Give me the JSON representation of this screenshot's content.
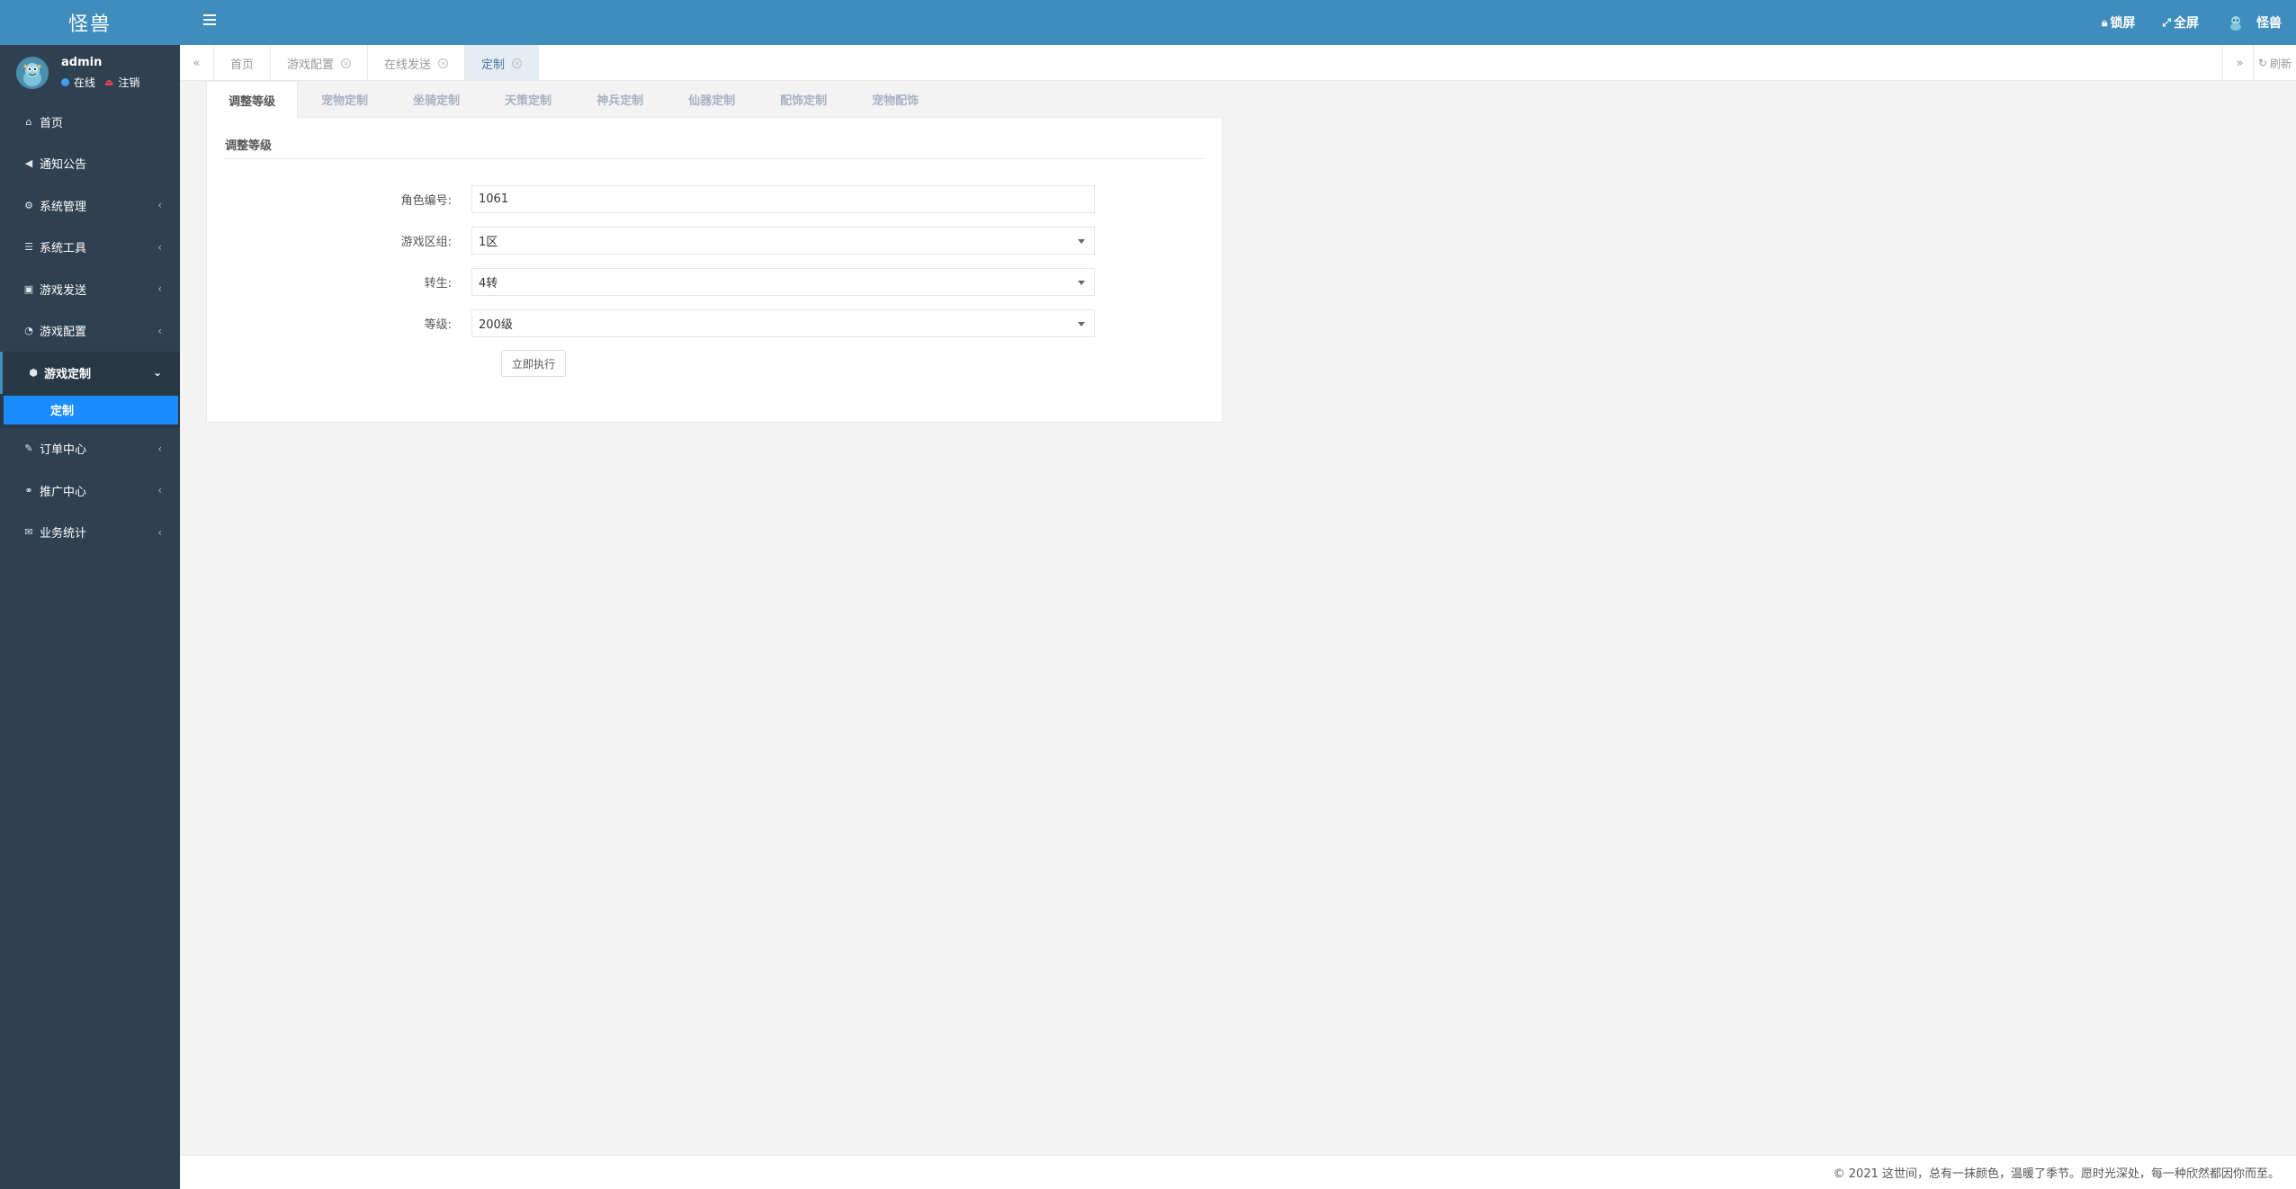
{
  "brand": {
    "title": "怪兽"
  },
  "user": {
    "name": "admin",
    "status": "在线",
    "logout": "注销"
  },
  "sidebar": {
    "items": [
      {
        "label": "首页",
        "icon": "home-icon",
        "glyph": "⌂",
        "has_arrow": false
      },
      {
        "label": "通知公告",
        "icon": "bullhorn-icon",
        "glyph": "📢",
        "has_arrow": false
      },
      {
        "label": "系统管理",
        "icon": "gear-icon",
        "glyph": "⚙",
        "has_arrow": true
      },
      {
        "label": "系统工具",
        "icon": "bars-icon",
        "glyph": "☰",
        "has_arrow": true
      },
      {
        "label": "游戏发送",
        "icon": "gift-icon",
        "glyph": "🎁",
        "has_arrow": true
      },
      {
        "label": "游戏配置",
        "icon": "dashboard-icon",
        "glyph": "◔",
        "has_arrow": true
      }
    ],
    "active_group": {
      "label": "游戏定制",
      "icon": "cube-icon",
      "glyph": "⬡",
      "sub_item": "定制"
    },
    "items_after": [
      {
        "label": "订单中心",
        "icon": "brush-icon",
        "glyph": "✎",
        "has_arrow": true
      },
      {
        "label": "推广中心",
        "icon": "handshake-icon",
        "glyph": "🤝",
        "has_arrow": true
      },
      {
        "label": "业务统计",
        "icon": "envelope-icon",
        "glyph": "✉",
        "has_arrow": true
      }
    ]
  },
  "header": {
    "lock": "锁屏",
    "fullscreen": "全屏",
    "username": "怪兽"
  },
  "page_tabs": [
    {
      "label": "首页",
      "closable": false,
      "active": false
    },
    {
      "label": "游戏配置",
      "closable": true,
      "active": false
    },
    {
      "label": "在线发送",
      "closable": true,
      "active": false
    },
    {
      "label": "定制",
      "closable": true,
      "active": true
    }
  ],
  "refresh": "刷新",
  "content_tabs": [
    "调整等级",
    "宠物定制",
    "坐骑定制",
    "天策定制",
    "神兵定制",
    "仙器定制",
    "配饰定制",
    "宠物配饰"
  ],
  "panel": {
    "title": "调整等级",
    "fields": {
      "role_id": {
        "label": "角色编号:",
        "value": "1061"
      },
      "zone": {
        "label": "游戏区组:",
        "value": "1区"
      },
      "rebirth": {
        "label": "转生:",
        "value": "4转"
      },
      "level": {
        "label": "等级:",
        "value": "200级"
      }
    },
    "submit": "立即执行"
  },
  "footer": {
    "text": "© 2021 这世间，总有一抹颜色，温暖了季节。愿时光深处，每一种欣然都因你而至。"
  },
  "colors": {
    "header": "#3f8dbc",
    "sidebar": "#2f4050",
    "active_sub": "#1a8cff"
  }
}
